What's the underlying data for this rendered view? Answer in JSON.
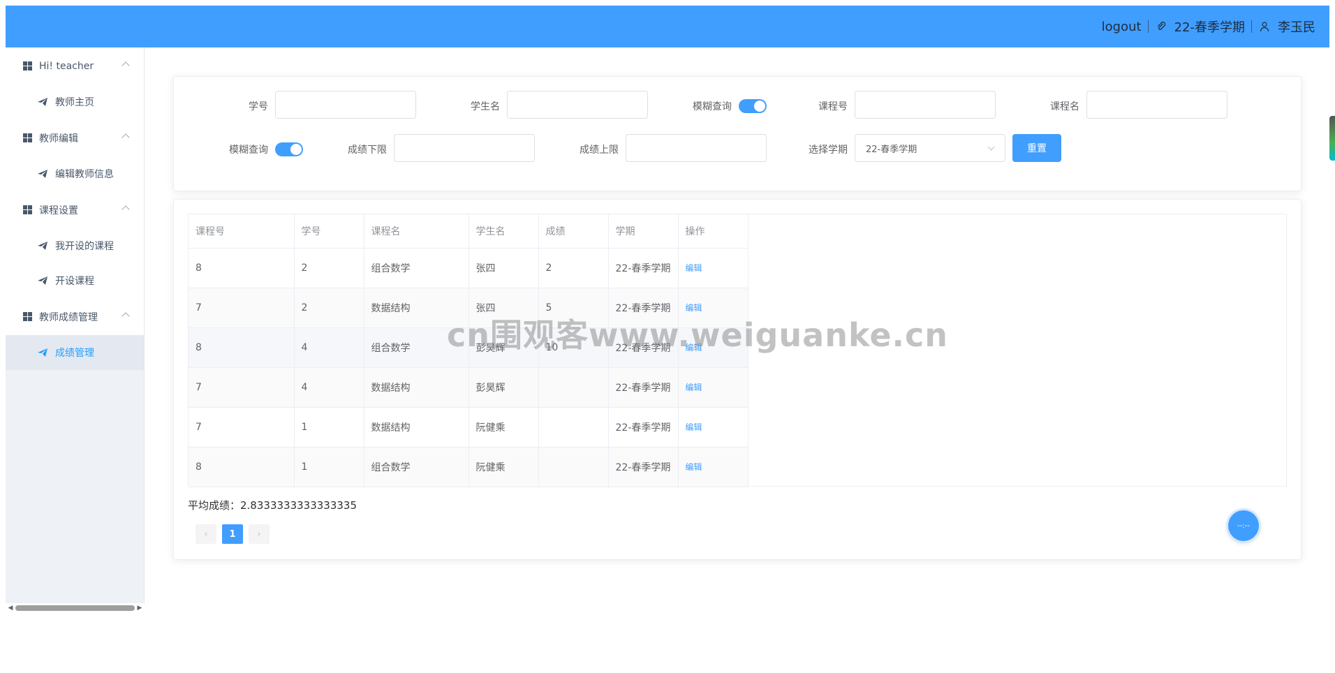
{
  "header": {
    "logout": "logout",
    "semester": "22-春季学期",
    "user": "李玉民",
    "icons": [
      "paperclip-icon",
      "user-icon"
    ]
  },
  "sidebar": {
    "groups": [
      {
        "title": "Hi! teacher",
        "items": [
          {
            "label": "教师主页",
            "active": false
          }
        ]
      },
      {
        "title": "教师编辑",
        "items": [
          {
            "label": "编辑教师信息",
            "active": false
          }
        ]
      },
      {
        "title": "课程设置",
        "items": [
          {
            "label": "我开设的课程",
            "active": false
          },
          {
            "label": "开设课程",
            "active": false
          }
        ]
      },
      {
        "title": "教师成绩管理",
        "items": [
          {
            "label": "成绩管理",
            "active": true
          }
        ]
      }
    ]
  },
  "filters": {
    "student_id_label": "学号",
    "student_name_label": "学生名",
    "fuzzy1_label": "模糊查询",
    "course_id_label": "课程号",
    "course_name_label": "课程名",
    "fuzzy2_label": "模糊查询",
    "score_min_label": "成绩下限",
    "score_max_label": "成绩上限",
    "semester_label": "选择学期",
    "semester_value": "22-春季学期",
    "reset_label": "重置",
    "fuzzy1_on": true,
    "fuzzy2_on": true
  },
  "table": {
    "columns": [
      "课程号",
      "学号",
      "课程名",
      "学生名",
      "成绩",
      "学期",
      "操作"
    ],
    "rows": [
      [
        "8",
        "2",
        "组合数学",
        "张四",
        "2",
        "22-春季学期",
        "编辑"
      ],
      [
        "7",
        "2",
        "数据结构",
        "张四",
        "5",
        "22-春季学期",
        "编辑"
      ],
      [
        "8",
        "4",
        "组合数学",
        "彭昊辉",
        "10",
        "22-春季学期",
        "编辑"
      ],
      [
        "7",
        "4",
        "数据结构",
        "彭昊辉",
        "",
        "22-春季学期",
        "编辑"
      ],
      [
        "7",
        "1",
        "数据结构",
        "阮健乘",
        "",
        "22-春季学期",
        "编辑"
      ],
      [
        "8",
        "1",
        "组合数学",
        "阮健乘",
        "",
        "22-春季学期",
        "编辑"
      ]
    ]
  },
  "average_text": "平均成绩：2.8333333333333335",
  "pagination": {
    "prev": "‹",
    "current": "1",
    "next": "›"
  },
  "watermark": "cn围观客www.weiguanke.cn",
  "fab_text": "--:--",
  "colors": {
    "primary": "#409eff",
    "sidebar_bg": "#eef1f6",
    "active_text": "#20a0ff"
  }
}
